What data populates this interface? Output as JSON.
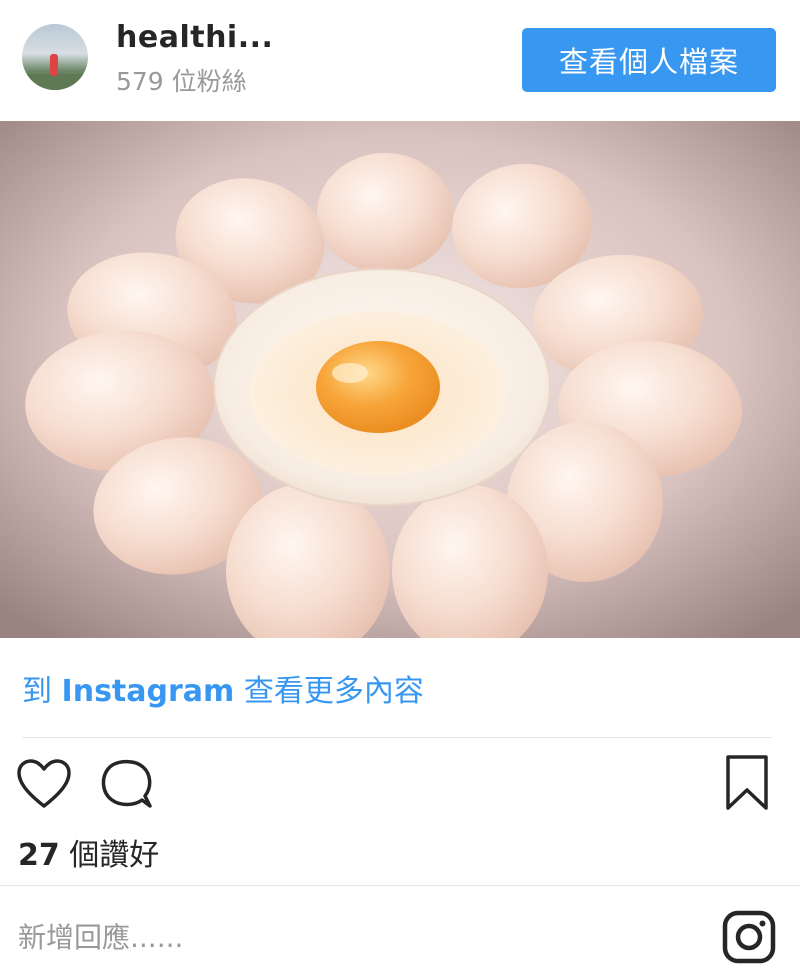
{
  "header": {
    "username": "healthi...",
    "followers": "579 位粉絲",
    "profile_button": "查看個人檔案"
  },
  "photo": {
    "subject": "eggs-around-bowl-with-yolk"
  },
  "link": {
    "prefix": "到",
    "brand": "Instagram",
    "suffix": "查看更多內容"
  },
  "actions": {
    "icons": [
      "heart-icon",
      "comment-icon",
      "bookmark-icon"
    ]
  },
  "likes": {
    "count": "27",
    "label": "個讚好"
  },
  "comment": {
    "placeholder": "新增回應......"
  },
  "colors": {
    "accent": "#3897f0",
    "text": "#262626",
    "muted": "#999999"
  }
}
